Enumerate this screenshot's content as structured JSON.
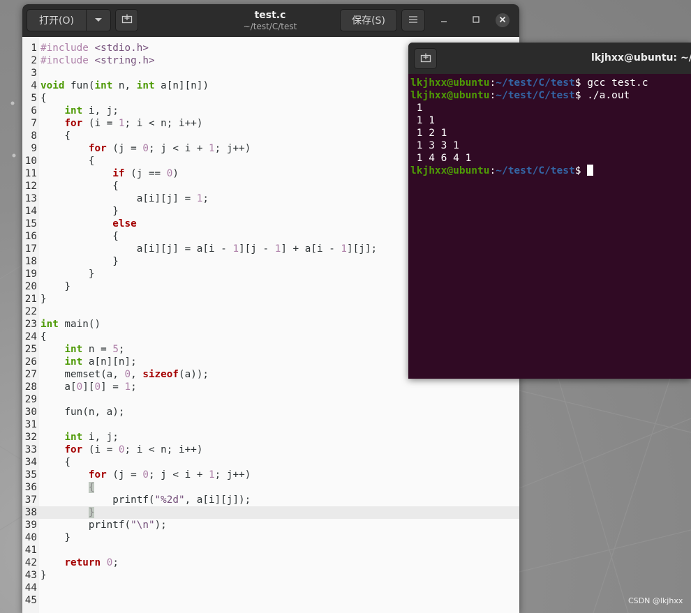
{
  "gedit": {
    "open_label": "打开(O)",
    "save_label": "保存(S)",
    "title": "test.c",
    "subtitle": "~/test/C/test",
    "minimize_icon": "minimize-icon",
    "maximize_icon": "maximize-icon",
    "close_icon": "close-icon",
    "lines": [
      {
        "n": "1",
        "code": "#include <stdio.h>"
      },
      {
        "n": "2",
        "code": "#include <string.h>"
      },
      {
        "n": "3",
        "code": ""
      },
      {
        "n": "4",
        "code": "void fun(int n, int a[n][n])"
      },
      {
        "n": "5",
        "code": "{"
      },
      {
        "n": "6",
        "code": "    int i, j;"
      },
      {
        "n": "7",
        "code": "    for (i = 1; i < n; i++)"
      },
      {
        "n": "8",
        "code": "    {"
      },
      {
        "n": "9",
        "code": "        for (j = 0; j < i + 1; j++)"
      },
      {
        "n": "10",
        "code": "        {"
      },
      {
        "n": "11",
        "code": "            if (j == 0)"
      },
      {
        "n": "12",
        "code": "            {"
      },
      {
        "n": "13",
        "code": "                a[i][j] = 1;"
      },
      {
        "n": "14",
        "code": "            }"
      },
      {
        "n": "15",
        "code": "            else"
      },
      {
        "n": "16",
        "code": "            {"
      },
      {
        "n": "17",
        "code": "                a[i][j] = a[i - 1][j - 1] + a[i - 1][j];"
      },
      {
        "n": "18",
        "code": "            }"
      },
      {
        "n": "19",
        "code": "        }"
      },
      {
        "n": "20",
        "code": "    }"
      },
      {
        "n": "21",
        "code": "}"
      },
      {
        "n": "22",
        "code": ""
      },
      {
        "n": "23",
        "code": "int main()"
      },
      {
        "n": "24",
        "code": "{"
      },
      {
        "n": "25",
        "code": "    int n = 5;"
      },
      {
        "n": "26",
        "code": "    int a[n][n];"
      },
      {
        "n": "27",
        "code": "    memset(a, 0, sizeof(a));"
      },
      {
        "n": "28",
        "code": "    a[0][0] = 1;"
      },
      {
        "n": "29",
        "code": ""
      },
      {
        "n": "30",
        "code": "    fun(n, a);"
      },
      {
        "n": "31",
        "code": ""
      },
      {
        "n": "32",
        "code": "    int i, j;"
      },
      {
        "n": "33",
        "code": "    for (i = 0; i < n; i++)"
      },
      {
        "n": "34",
        "code": "    {"
      },
      {
        "n": "35",
        "code": "        for (j = 0; j < i + 1; j++)"
      },
      {
        "n": "36",
        "code": "        {"
      },
      {
        "n": "37",
        "code": "            printf(\"%2d\", a[i][j]);"
      },
      {
        "n": "38",
        "code": "        }"
      },
      {
        "n": "39",
        "code": "        printf(\"\\n\");"
      },
      {
        "n": "40",
        "code": "    }"
      },
      {
        "n": "41",
        "code": ""
      },
      {
        "n": "42",
        "code": "    return 0;"
      },
      {
        "n": "43",
        "code": "}"
      },
      {
        "n": "44",
        "code": ""
      },
      {
        "n": "45",
        "code": ""
      }
    ],
    "current_line": 38
  },
  "terminal": {
    "title": "lkjhxx@ubuntu: ~/test/C/test",
    "user_host": "lkjhxx@ubuntu",
    "path": "~/test/C/test",
    "lines": [
      {
        "type": "prompt",
        "cmd": "gcc test.c"
      },
      {
        "type": "prompt",
        "cmd": "./a.out"
      },
      {
        "type": "out",
        "text": " 1"
      },
      {
        "type": "out",
        "text": " 1 1"
      },
      {
        "type": "out",
        "text": " 1 2 1"
      },
      {
        "type": "out",
        "text": " 1 3 3 1"
      },
      {
        "type": "out",
        "text": " 1 4 6 4 1"
      },
      {
        "type": "prompt",
        "cmd": "",
        "cursor": true
      }
    ]
  },
  "watermark": "CSDN @lkjhxx"
}
